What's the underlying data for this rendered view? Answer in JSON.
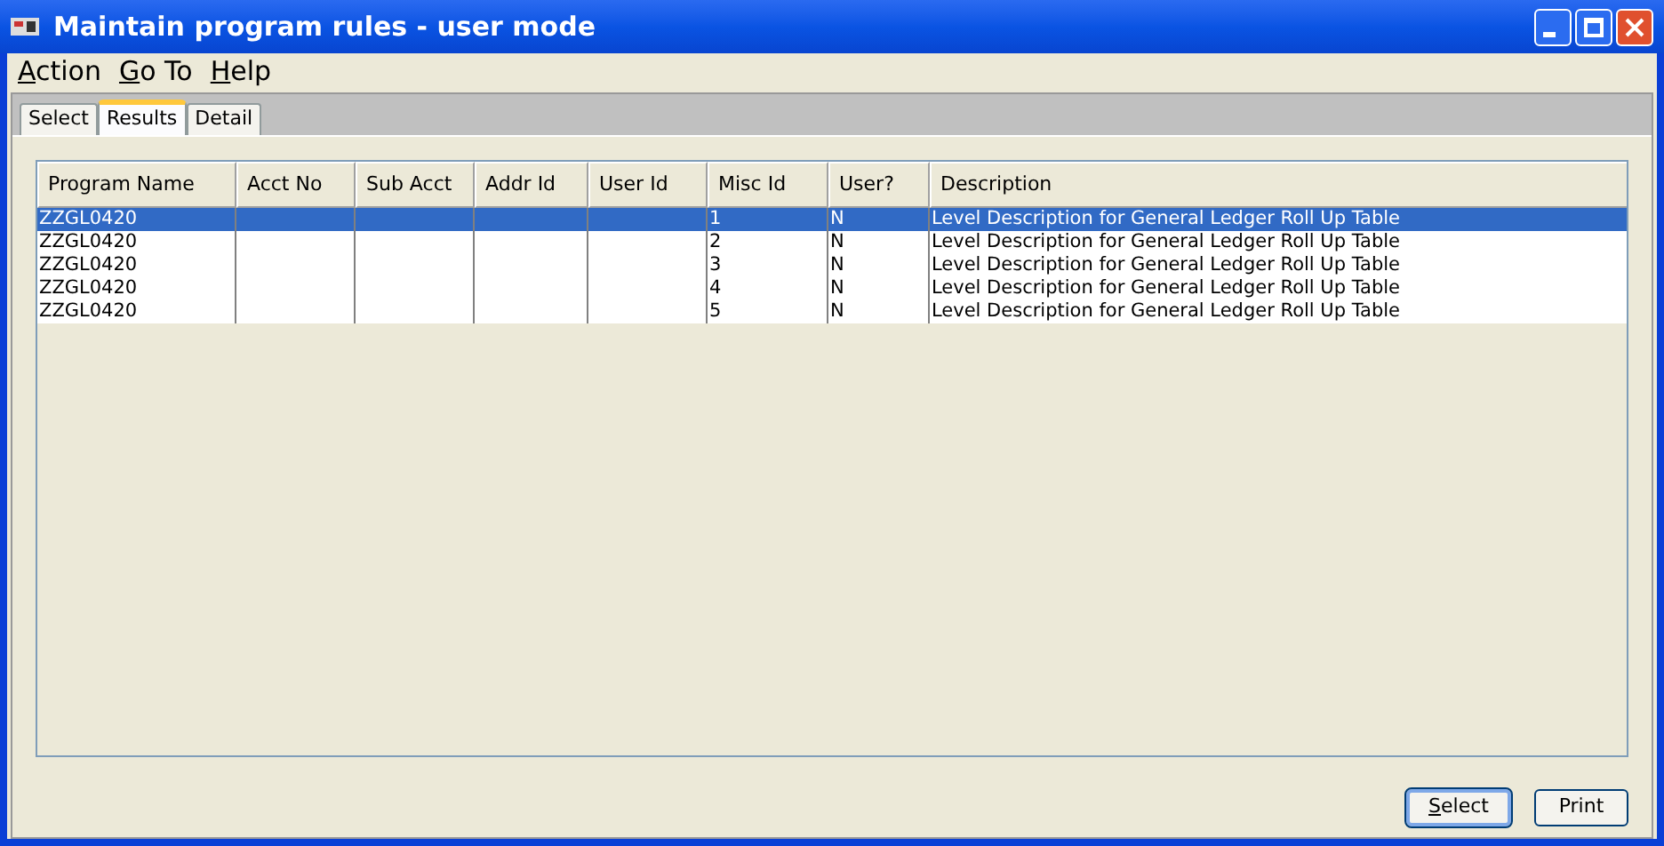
{
  "window": {
    "title": "Maintain program rules - user mode"
  },
  "menu": [
    "Action",
    "Go To",
    "Help"
  ],
  "tabs": [
    {
      "label": "Select",
      "selected": false
    },
    {
      "label": "Results",
      "selected": true
    },
    {
      "label": "Detail",
      "selected": false
    }
  ],
  "table": {
    "columns": [
      "Program Name",
      "Acct No",
      "Sub Acct",
      "Addr Id",
      "User Id",
      "Misc Id",
      "User?",
      "Description"
    ],
    "rows": [
      {
        "selected": true,
        "cells": [
          "ZZGL0420",
          "",
          "",
          "",
          "",
          "1",
          "N",
          "Level Description for General Ledger Roll Up Table"
        ]
      },
      {
        "selected": false,
        "cells": [
          "ZZGL0420",
          "",
          "",
          "",
          "",
          "2",
          "N",
          "Level Description for General Ledger Roll Up Table"
        ]
      },
      {
        "selected": false,
        "cells": [
          "ZZGL0420",
          "",
          "",
          "",
          "",
          "3",
          "N",
          "Level Description for General Ledger Roll Up Table"
        ]
      },
      {
        "selected": false,
        "cells": [
          "ZZGL0420",
          "",
          "",
          "",
          "",
          "4",
          "N",
          "Level Description for General Ledger Roll Up Table"
        ]
      },
      {
        "selected": false,
        "cells": [
          "ZZGL0420",
          "",
          "",
          "",
          "",
          "5",
          "N",
          "Level Description for General Ledger Roll Up Table"
        ]
      }
    ]
  },
  "buttons": [
    {
      "label": "Select",
      "default": true
    },
    {
      "label": "Print",
      "default": false
    }
  ]
}
